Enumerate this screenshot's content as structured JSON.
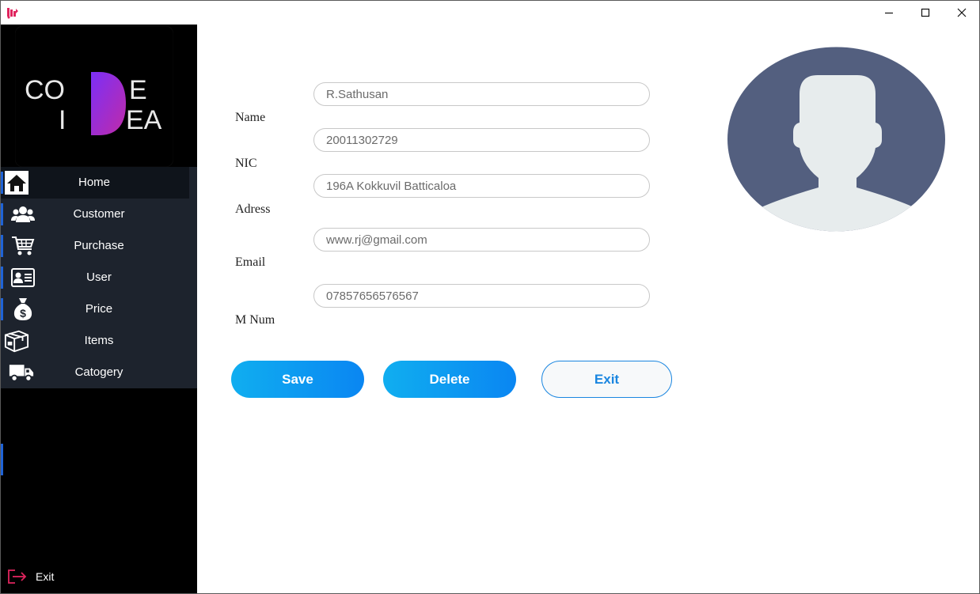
{
  "window": {
    "controls": [
      "minimize",
      "maximize",
      "close"
    ]
  },
  "logo": {
    "line1_left": "CO",
    "line1_right": "E",
    "line2_left": "I",
    "line2_right": "EA",
    "big_letter": "D"
  },
  "sidebar": {
    "items": [
      {
        "label": "Home",
        "icon": "home-icon"
      },
      {
        "label": "Customer",
        "icon": "users-icon"
      },
      {
        "label": "Purchase",
        "icon": "cart-icon"
      },
      {
        "label": "User",
        "icon": "id-card-icon"
      },
      {
        "label": "Price",
        "icon": "money-bag-icon"
      },
      {
        "label": "Items",
        "icon": "box-icon"
      },
      {
        "label": "Catogery",
        "icon": "truck-icon"
      }
    ],
    "exit_label": "Exit"
  },
  "form": {
    "name_label": "Name",
    "name_value": "R.Sathusan",
    "nic_label": "NIC",
    "nic_value": "20011302729",
    "address_label": "Adress",
    "address_value": "196A Kokkuvil Batticaloa",
    "email_label": "Email",
    "email_value": "www.rj@gmail.com",
    "mobile_label": "M Num",
    "mobile_value": "07857656576567"
  },
  "buttons": {
    "save": "Save",
    "delete": "Delete",
    "exit": "Exit"
  },
  "colors": {
    "sidebar_bg": "#000000",
    "nav_bg": "#1d232d",
    "accent": "#1f63d6",
    "button_gradient_start": "#10aef0",
    "button_gradient_end": "#0a86f2",
    "avatar_bg": "#535f7f",
    "avatar_fg": "#e7eced"
  }
}
